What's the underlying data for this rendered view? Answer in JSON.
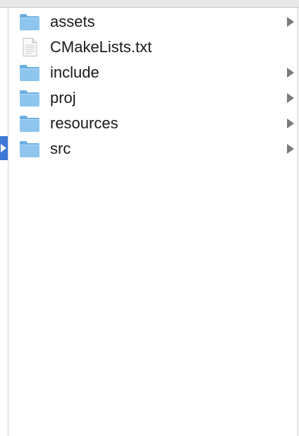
{
  "items": [
    {
      "name": "assets",
      "type": "folder",
      "icon": "folder-icon",
      "has_children": true
    },
    {
      "name": "CMakeLists.txt",
      "type": "file",
      "icon": "text-file-icon",
      "has_children": false
    },
    {
      "name": "include",
      "type": "folder",
      "icon": "folder-icon",
      "has_children": true
    },
    {
      "name": "proj",
      "type": "folder",
      "icon": "folder-icon",
      "has_children": true
    },
    {
      "name": "resources",
      "type": "folder",
      "icon": "folder-icon",
      "has_children": true
    },
    {
      "name": "src",
      "type": "folder",
      "icon": "folder-icon",
      "has_children": true
    }
  ],
  "colors": {
    "folder_body": "#8ec5ef",
    "folder_tab": "#6aafe4",
    "selection": "#3d78d6",
    "disclosure": "#7a7a7a",
    "text": "#1a1a1a"
  }
}
